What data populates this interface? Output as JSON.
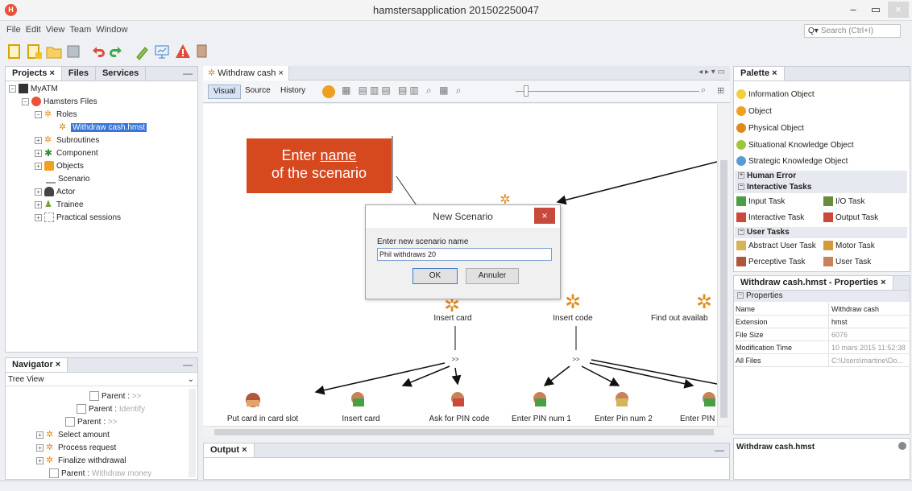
{
  "window": {
    "title": "hamstersapplication 201502250047",
    "minimize": "–",
    "maximize": "▭",
    "close": "×"
  },
  "menu": [
    "File",
    "Edit",
    "View",
    "Team",
    "Window"
  ],
  "search": {
    "placeholder": "Search (Ctrl+I)"
  },
  "projects_panel": {
    "tabs": [
      "Projects ×",
      "Files",
      "Services"
    ],
    "tree": {
      "root": "MyATM",
      "hamsters_files": "Hamsters Files",
      "roles": "Roles",
      "selected_file": "Withdraw cash.hmst",
      "subroutines": "Subroutines",
      "component": "Component",
      "objects": "Objects",
      "scenario": "Scenario",
      "actor": "Actor",
      "trainee": "Trainee",
      "practical_sessions": "Practical sessions"
    }
  },
  "navigator": {
    "title": "Navigator ×",
    "view": "Tree View",
    "rows": [
      {
        "label": "Parent : ",
        "hint": ">>"
      },
      {
        "label": "Parent : ",
        "hint": "Identify"
      },
      {
        "label": "Parent : ",
        "hint": ">>"
      },
      {
        "label": "Select amount",
        "hint": ""
      },
      {
        "label": "Process request",
        "hint": ""
      },
      {
        "label": "Finalize withdrawal",
        "hint": ""
      },
      {
        "label": "Parent : ",
        "hint": "Withdraw money"
      }
    ]
  },
  "editor": {
    "tab": "Withdraw cash ×",
    "views": [
      "Visual",
      "Source",
      "History"
    ],
    "nodes": [
      {
        "label": "Insert card"
      },
      {
        "label": "Insert code"
      },
      {
        "label": "Find out availab"
      }
    ],
    "operators": [
      ">>",
      ">>"
    ],
    "leaves": [
      "Put card in card slot",
      "Insert card",
      "Ask for PIN code",
      "Enter PIN num 1",
      "Enter Pin num 2",
      "Enter PIN"
    ]
  },
  "callout": {
    "line1": "Enter ",
    "underlined": "name",
    "line2": "of the scenario"
  },
  "dialog": {
    "title": "New Scenario",
    "close": "×",
    "prompt": "Enter new scenario name",
    "value": "Phil withdraws 20",
    "ok": "OK",
    "cancel": "Annuler"
  },
  "palette": {
    "title": "Palette ×",
    "objects": [
      "Information Object",
      "Object",
      "Physical Object",
      "Situational Knowledge Object",
      "Strategic Knowledge Object"
    ],
    "human_error": "Human Error",
    "interactive_tasks": "Interactive Tasks",
    "interactive_items": [
      "Input Task",
      "I/O Task",
      "Interactive Task",
      "Output Task"
    ],
    "user_tasks": "User Tasks",
    "user_items": [
      "Abstract User Task",
      "Motor Task",
      "Perceptive Task",
      "User Task"
    ]
  },
  "properties": {
    "title": "Withdraw cash.hmst - Properties ×",
    "section": "Properties",
    "rows": [
      {
        "k": "Name",
        "v": "Withdraw cash"
      },
      {
        "k": "Extension",
        "v": "hmst"
      },
      {
        "k": "File Size",
        "v": "6076"
      },
      {
        "k": "Modification Time",
        "v": "10 mars 2015 11:52:38"
      },
      {
        "k": "All Files",
        "v": "C:\\Users\\martine\\Do..."
      }
    ],
    "footer": "Withdraw cash.hmst"
  },
  "output": {
    "title": "Output ×"
  },
  "colors": {
    "accent_orange": "#d6481e",
    "selection": "#3875d7",
    "panel_border": "#c7ccd4"
  }
}
